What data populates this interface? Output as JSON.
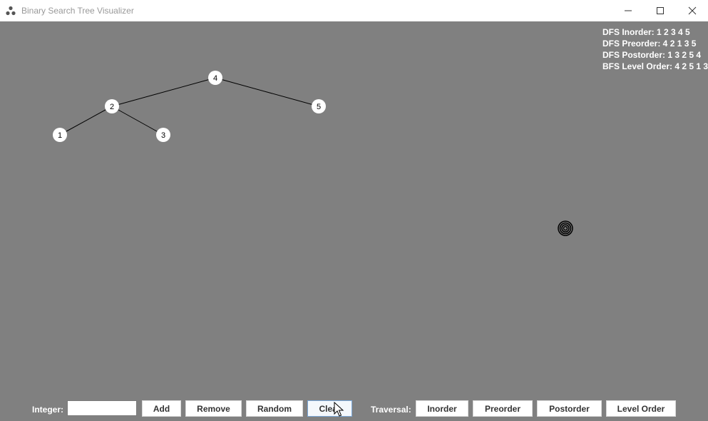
{
  "window": {
    "title": "Binary Search Tree Visualizer",
    "icon": "tree-nodes-icon",
    "controls": [
      "minimize-icon",
      "maximize-icon",
      "close-icon"
    ]
  },
  "colors": {
    "canvas_bg": "#808080",
    "node_fill": "#ffffff",
    "edge": "#000000",
    "text_light": "#ffffff"
  },
  "traversals": {
    "inorder": "DFS Inorder: 1 2 3 4 5",
    "preorder": "DFS Preorder: 4 2 1 3 5",
    "postorder": "DFS Postorder: 1 3 2 5 4",
    "level": "BFS Level Order: 4 2 5 1 3"
  },
  "tree": {
    "nodes": [
      "4",
      "2",
      "5",
      "1",
      "3"
    ],
    "edges": [
      [
        "4",
        "2"
      ],
      [
        "4",
        "5"
      ],
      [
        "2",
        "1"
      ],
      [
        "2",
        "3"
      ]
    ]
  },
  "toolbar": {
    "integer_label": "Integer:",
    "integer_value": "",
    "add": "Add",
    "remove": "Remove",
    "random": "Random",
    "clear": "Clear",
    "traversal_label": "Traversal:",
    "inorder": "Inorder",
    "preorder": "Preorder",
    "postorder": "Postorder",
    "level_order": "Level Order"
  }
}
